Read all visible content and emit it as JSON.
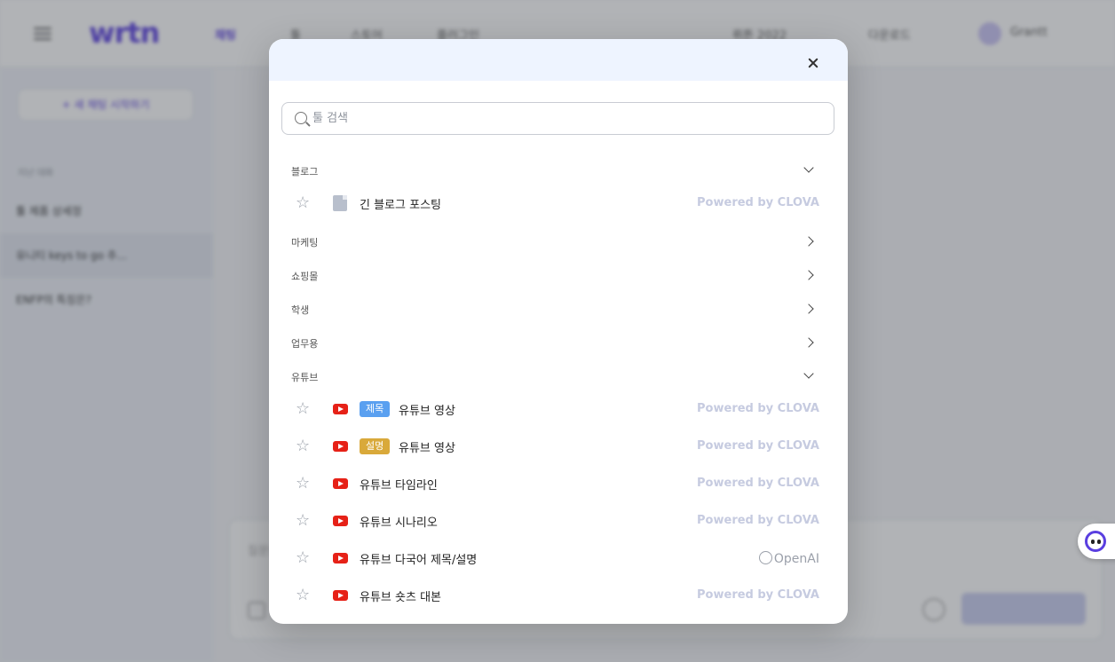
{
  "background": {
    "logo": "wrtn",
    "nav": [
      "채팅",
      "툴",
      "스토어",
      "플러그인"
    ],
    "top_right": [
      "뤼튼 2022",
      "다운로드",
      "Grantt"
    ],
    "sidebar": {
      "new_chat": "+ 새 채팅 시작하기",
      "section_label": "지난 대화",
      "items": [
        "툴 제품 상세정",
        "유니티 keys to go 추...",
        "ENFP의 특징은?"
      ]
    },
    "input_placeholder": "질문을 입력해주세요"
  },
  "modal": {
    "search_placeholder": "툴 검색",
    "categories": [
      {
        "label": "블로그",
        "expanded": true
      },
      {
        "label": "마케팅",
        "expanded": false
      },
      {
        "label": "쇼핑몰",
        "expanded": false
      },
      {
        "label": "학생",
        "expanded": false
      },
      {
        "label": "업무용",
        "expanded": false
      },
      {
        "label": "유튜브",
        "expanded": true
      }
    ],
    "blog_tools": [
      {
        "icon": "document-icon",
        "name": "긴 블로그 포스팅",
        "provider": "Powered by CLOVA"
      }
    ],
    "youtube_tools": [
      {
        "icon": "youtube-icon",
        "badge": "제목",
        "name": "유튜브 영상",
        "provider": "Powered by CLOVA"
      },
      {
        "icon": "youtube-icon",
        "badge": "설명",
        "name": "유튜브 영상",
        "provider": "Powered by CLOVA"
      },
      {
        "icon": "youtube-icon",
        "name": "유튜브 타임라인",
        "provider": "Powered by CLOVA"
      },
      {
        "icon": "youtube-icon",
        "name": "유튜브 시나리오",
        "provider": "Powered by CLOVA"
      },
      {
        "icon": "youtube-icon",
        "name": "유튜브 다국어 제목/설명",
        "provider": "OpenAI"
      },
      {
        "icon": "youtube-icon",
        "name": "유튜브 숏츠 대본",
        "provider": "Powered by CLOVA"
      }
    ]
  },
  "colors": {
    "brand": "#5a3fe0",
    "youtube": "#e62117",
    "badge_title": "#5aa0f0",
    "badge_desc": "#d9a93a",
    "provider_text": "#c6cbe0"
  }
}
